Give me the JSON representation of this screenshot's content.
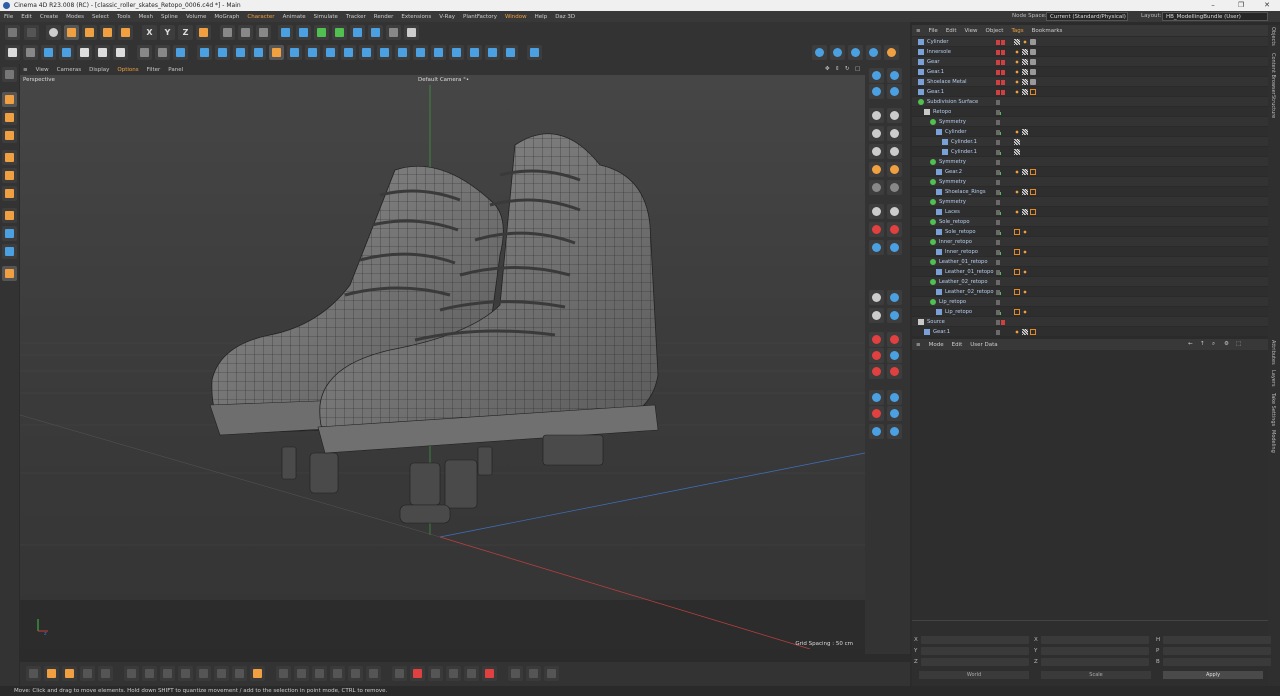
{
  "window": {
    "title": "Cinema 4D R23.008 (RC) - [classic_roller_skates_Retopo_0006.c4d *] - Main",
    "controls": [
      "–",
      "❐",
      "✕"
    ]
  },
  "menubar": {
    "items": [
      "File",
      "Edit",
      "Create",
      "Modes",
      "Select",
      "Tools",
      "Mesh",
      "Spline",
      "Volume",
      "MoGraph",
      "Character",
      "Animate",
      "Simulate",
      "Tracker",
      "Render",
      "Extensions",
      "V-Ray",
      "PlantFactory",
      "Window",
      "Help",
      "Daz 3D"
    ],
    "node_space_label": "Node Space:",
    "node_space_value": "Current (Standard/Physical)",
    "layout_label": "Layout:",
    "layout_value": "HB_ModellingBundle (User)"
  },
  "viewport_menu": {
    "items": [
      "View",
      "Cameras",
      "Display",
      "Options",
      "Filter",
      "Panel"
    ],
    "view_name": "Perspective",
    "camera_name": "Default Camera °•",
    "grid_spacing": "Grid Spacing : 50 cm"
  },
  "object_manager": {
    "menu": [
      "File",
      "Edit",
      "View",
      "Object",
      "Tags",
      "Bookmarks"
    ],
    "objects": [
      {
        "name": "Cylinder",
        "depth": 0,
        "tags": [
          "check",
          "dot",
          "gray"
        ],
        "icon": "poly"
      },
      {
        "name": "Innersole",
        "depth": 0,
        "tags": [
          "dot",
          "check",
          "gray"
        ],
        "icon": "poly"
      },
      {
        "name": "Gear",
        "depth": 0,
        "tags": [
          "dot",
          "check",
          "gray"
        ],
        "icon": "poly"
      },
      {
        "name": "Gear.1",
        "depth": 0,
        "tags": [
          "dot",
          "check",
          "gray"
        ],
        "icon": "poly"
      },
      {
        "name": "Shoelace Metal",
        "depth": 0,
        "tags": [
          "dot",
          "check",
          "gray"
        ],
        "icon": "poly"
      },
      {
        "name": "Gear.1",
        "depth": 0,
        "tags": [
          "dot",
          "check",
          "rect"
        ],
        "icon": "poly"
      },
      {
        "name": "Subdivision Surface",
        "depth": 0,
        "tags": [],
        "icon": "sds"
      },
      {
        "name": "Retopo",
        "depth": 1,
        "tags": [],
        "icon": "null"
      },
      {
        "name": "Symmetry",
        "depth": 2,
        "tags": [],
        "icon": "sym"
      },
      {
        "name": "Cylinder",
        "depth": 3,
        "tags": [
          "dot",
          "check"
        ],
        "icon": "poly"
      },
      {
        "name": "Cylinder.1",
        "depth": 4,
        "tags": [
          "check"
        ],
        "icon": "poly"
      },
      {
        "name": "Cylinder.1",
        "depth": 4,
        "tags": [
          "check"
        ],
        "icon": "poly"
      },
      {
        "name": "Symmetry",
        "depth": 2,
        "tags": [],
        "icon": "sym"
      },
      {
        "name": "Gear.2",
        "depth": 3,
        "tags": [
          "dot",
          "check",
          "rect"
        ],
        "icon": "poly"
      },
      {
        "name": "Symmetry",
        "depth": 2,
        "tags": [],
        "icon": "sym"
      },
      {
        "name": "Shoelace_Rings",
        "depth": 3,
        "tags": [
          "dot",
          "check",
          "rect"
        ],
        "icon": "poly"
      },
      {
        "name": "Symmetry",
        "depth": 2,
        "tags": [],
        "icon": "sym"
      },
      {
        "name": "Laces",
        "depth": 3,
        "tags": [
          "dot",
          "check",
          "rect"
        ],
        "icon": "poly"
      },
      {
        "name": "Sole_retopo",
        "depth": 2,
        "tags": [],
        "icon": "sym"
      },
      {
        "name": "Sole_retopo",
        "depth": 3,
        "tags": [
          "rect",
          "dot"
        ],
        "icon": "poly"
      },
      {
        "name": "Inner_retopo",
        "depth": 2,
        "tags": [],
        "icon": "sym"
      },
      {
        "name": "Inner_retopo",
        "depth": 3,
        "tags": [
          "rect",
          "dot"
        ],
        "icon": "poly"
      },
      {
        "name": "Leather_01_retopo",
        "depth": 2,
        "tags": [],
        "icon": "sym"
      },
      {
        "name": "Leather_01_retopo",
        "depth": 3,
        "tags": [
          "rect",
          "dot"
        ],
        "icon": "poly"
      },
      {
        "name": "Leather_02_retopo",
        "depth": 2,
        "tags": [],
        "icon": "sym"
      },
      {
        "name": "Leather_02_retopo",
        "depth": 3,
        "tags": [
          "rect",
          "dot"
        ],
        "icon": "poly"
      },
      {
        "name": "Lip_retopo",
        "depth": 2,
        "tags": [],
        "icon": "sym"
      },
      {
        "name": "Lip_retopo",
        "depth": 3,
        "tags": [
          "rect",
          "dot"
        ],
        "icon": "poly"
      },
      {
        "name": "Source",
        "depth": 0,
        "tags": [],
        "icon": "null"
      },
      {
        "name": "Gear.1",
        "depth": 1,
        "tags": [
          "dot",
          "check",
          "rect"
        ],
        "icon": "poly"
      }
    ]
  },
  "attribute_manager": {
    "menu": [
      "Mode",
      "Edit",
      "User Data"
    ]
  },
  "coordinates": {
    "pos_labels": [
      "X",
      "Y",
      "Z"
    ],
    "size_labels": [
      "X",
      "Y",
      "Z"
    ],
    "rot_labels": [
      "H",
      "P",
      "B"
    ],
    "world_label": "World",
    "scale_label": "Scale",
    "apply_label": "Apply"
  },
  "side_tabs": [
    "Objects",
    "Content Browser",
    "Structure",
    "Attributes",
    "Layers",
    "Take Settings",
    "Modeling"
  ],
  "status": {
    "text": "Move: Click and drag to move elements. Hold down SHIFT to quantize movement / add to the selection in point mode, CTRL to remove."
  },
  "colors": {
    "accent": "#f0a040",
    "axis_x": "#c04040",
    "axis_y": "#40c040",
    "axis_z": "#4070c0",
    "object_name": "#b8d0f0"
  }
}
